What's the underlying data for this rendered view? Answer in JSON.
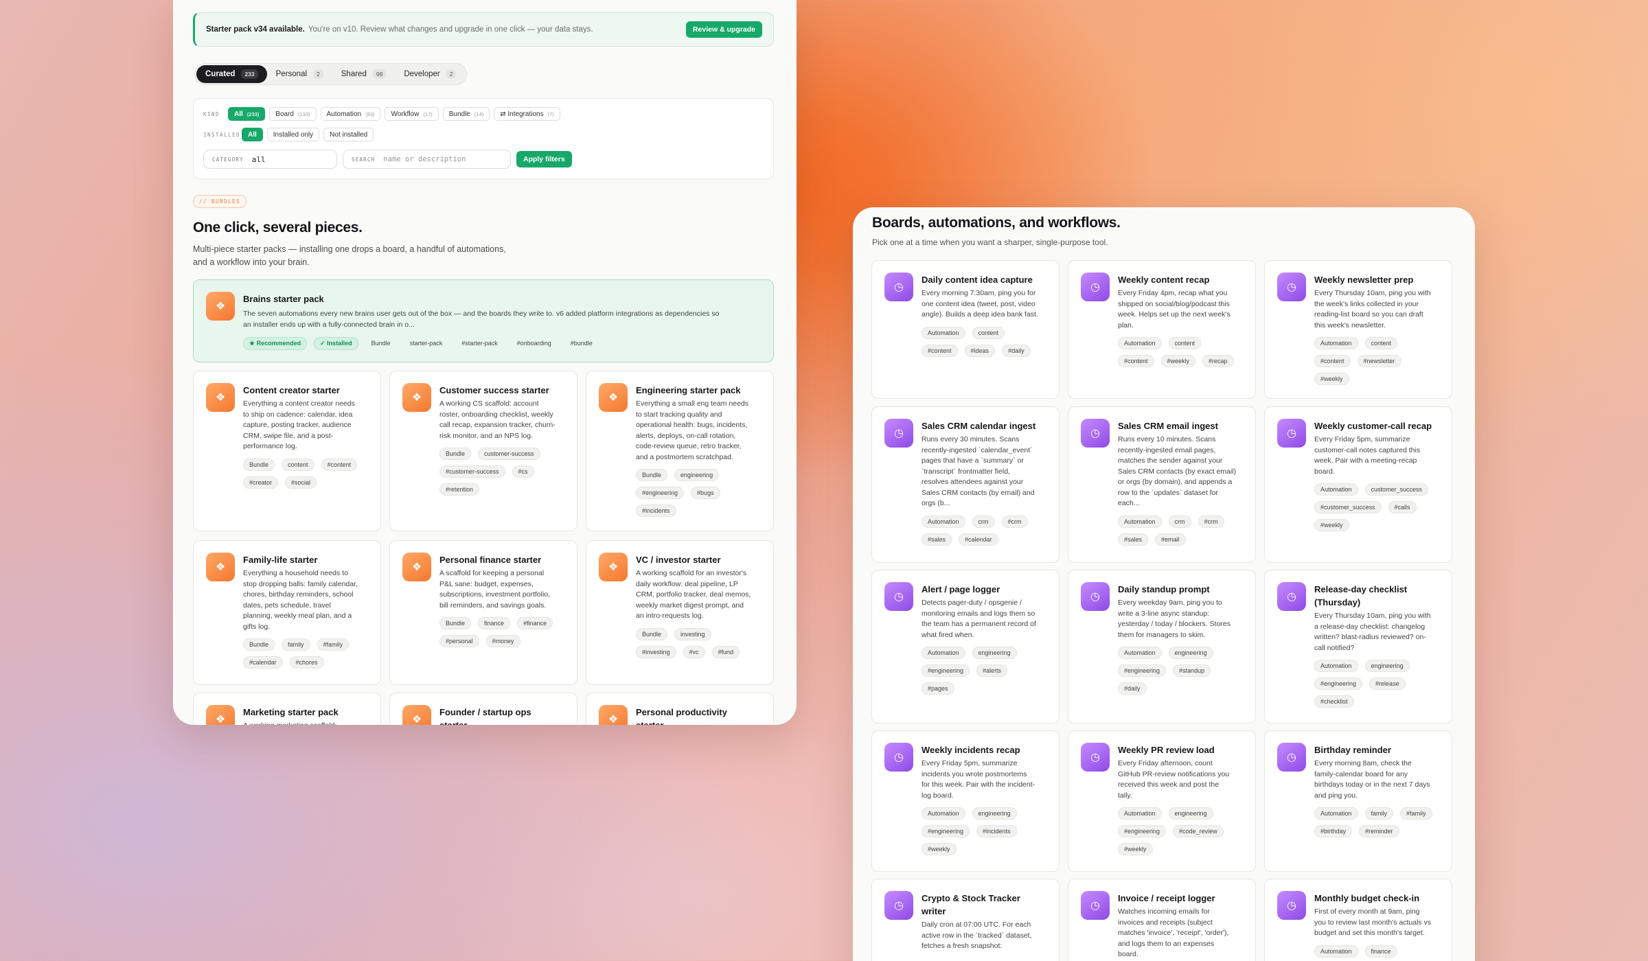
{
  "banner": {
    "title": "Starter pack v34 available.",
    "text": "You're on v10. Review what changes and upgrade in one click — your data stays.",
    "button": "Review & upgrade"
  },
  "tabs": [
    {
      "label": "Curated",
      "count": "233"
    },
    {
      "label": "Personal",
      "count": "2"
    },
    {
      "label": "Shared",
      "count": "98"
    },
    {
      "label": "Developer",
      "count": "2"
    }
  ],
  "filters": {
    "kind_label": "KIND",
    "kinds": [
      {
        "label": "All",
        "count": "(233)"
      },
      {
        "label": "Board",
        "count": "(133)"
      },
      {
        "label": "Automation",
        "count": "(83)"
      },
      {
        "label": "Workflow",
        "count": "(17)"
      },
      {
        "label": "Bundle",
        "count": "(14)"
      },
      {
        "label": "⇄ Integrations",
        "count": "(7)"
      }
    ],
    "installed_label": "INSTALLED",
    "installed": [
      "All",
      "Installed only",
      "Not installed"
    ],
    "category_label": "CATEGORY",
    "category_value": "all",
    "search_label": "SEARCH",
    "search_placeholder": "name or description",
    "apply": "Apply filters"
  },
  "bundles": {
    "kicker": "// BUNDLES",
    "heading": "One click, several pieces.",
    "sub_lines": [
      "Multi-piece starter packs — installing one drops a board, a handful of automations,",
      "and a workflow into your brain."
    ],
    "featured": {
      "title": "Brains starter pack",
      "desc_lines": [
        "The seven automations every new brains user gets out of the box — and the boards they write to. v6 added platform integrations as dependencies so",
        "an installer ends up with a fully-connected brain in o..."
      ],
      "tags": [
        "★ Recommended",
        "✓ Installed",
        "Bundle",
        "starter-pack",
        "#starter-pack",
        "#onboarding",
        "#bundle"
      ]
    },
    "cards": [
      {
        "title_lines": [
          "Content creator starter"
        ],
        "desc_lines": [
          "Everything a content creator needs",
          "to ship on cadence: calendar, idea",
          "capture, posting tracker, audience",
          "CRM, swipe file, and a post-",
          "performance log."
        ],
        "tags": [
          "Bundle",
          "content",
          "#content",
          "#creator",
          "#social"
        ]
      },
      {
        "title_lines": [
          "Customer success starter"
        ],
        "desc_lines": [
          "A working CS scaffold: account",
          "roster, onboarding checklist, weekly",
          "call recap, expansion tracker, churn-",
          "risk monitor, and an NPS log."
        ],
        "tags": [
          "Bundle",
          "customer-success",
          "#customer-success",
          "#cs",
          "#retention"
        ]
      },
      {
        "title_lines": [
          "Engineering starter pack"
        ],
        "desc_lines": [
          "Everything a small eng team needs",
          "to start tracking quality and",
          "operational health: bugs, incidents,",
          "alerts, deploys, on-call rotation,",
          "code-review queue, retro tracker,",
          "and a postmortem scratchpad."
        ],
        "tags": [
          "Bundle",
          "engineering",
          "#engineering",
          "#bugs",
          "#incidents"
        ]
      },
      {
        "title_lines": [
          "Family-life starter"
        ],
        "desc_lines": [
          "Everything a household needs to",
          "stop dropping balls: family calendar,",
          "chores, birthday reminders, school",
          "dates, pets schedule, travel",
          "planning, weekly meal plan, and a",
          "gifts log."
        ],
        "tags": [
          "Bundle",
          "family",
          "#family",
          "#calendar",
          "#chores"
        ]
      },
      {
        "title_lines": [
          "Personal finance starter"
        ],
        "desc_lines": [
          "A scaffold for keeping a personal",
          "P&L sane: budget, expenses,",
          "subscriptions, investment portfolio,",
          "bill reminders, and savings goals."
        ],
        "tags": [
          "Bundle",
          "finance",
          "#finance",
          "#personal",
          "#money"
        ]
      },
      {
        "title_lines": [
          "VC / investor starter"
        ],
        "desc_lines": [
          "A working scaffold for an investor's",
          "daily workflow: deal pipeline, LP",
          "CRM, portfolio tracker, deal memos,",
          "weekly market digest prompt, and",
          "an intro-requests log."
        ],
        "tags": [
          "Bundle",
          "investing",
          "#investing",
          "#vc",
          "#fund"
        ]
      },
      {
        "title_lines": [
          "Marketing starter pack"
        ],
        "desc_lines": [
          "A working marketing scaffold:"
        ],
        "tags": []
      },
      {
        "title_lines": [
          "Founder / startup ops",
          "starter"
        ],
        "desc_lines": [],
        "tags": []
      },
      {
        "title_lines": [
          "Personal productivity",
          "starter"
        ],
        "desc_lines": [],
        "tags": []
      }
    ]
  },
  "tools": {
    "heading": "Boards, automations, and workflows.",
    "sub": "Pick one at a time when you want a sharper, single-purpose tool.",
    "cards": [
      {
        "title_lines": [
          "Daily content idea capture"
        ],
        "desc_lines": [
          "Every morning 7:30am, ping you for",
          "one content idea (tweet, post, video",
          "angle). Builds a deep idea bank fast."
        ],
        "tags": [
          "Automation",
          "content",
          "#content",
          "#ideas",
          "#daily"
        ]
      },
      {
        "title_lines": [
          "Weekly content recap"
        ],
        "desc_lines": [
          "Every Friday 4pm, recap what you",
          "shipped on social/blog/podcast this",
          "week. Helps set up the next week's",
          "plan."
        ],
        "tags": [
          "Automation",
          "content",
          "#content",
          "#weekly",
          "#recap"
        ]
      },
      {
        "title_lines": [
          "Weekly newsletter prep"
        ],
        "desc_lines": [
          "Every Thursday 10am, ping you with",
          "the week's links collected in your",
          "reading-list board so you can draft",
          "this week's newsletter."
        ],
        "tags": [
          "Automation",
          "content",
          "#content",
          "#newsletter",
          "#weekly"
        ]
      },
      {
        "title_lines": [
          "Sales CRM calendar ingest"
        ],
        "desc_lines": [
          "Runs every 30 minutes. Scans",
          "recently-ingested `calendar_event`",
          "pages that have a `summary` or",
          "`transcript` frontmatter field,",
          "resolves attendees against your",
          "Sales CRM contacts (by email) and",
          "orgs (b..."
        ],
        "tags": [
          "Automation",
          "crm",
          "#crm",
          "#sales",
          "#calendar"
        ]
      },
      {
        "title_lines": [
          "Sales CRM email ingest"
        ],
        "desc_lines": [
          "Runs every 10 minutes. Scans",
          "recently-ingested email pages,",
          "matches the sender against your",
          "Sales CRM contacts (by exact email)",
          "or orgs (by domain), and appends a",
          "row to the `updates` dataset for",
          "each..."
        ],
        "tags": [
          "Automation",
          "crm",
          "#crm",
          "#sales",
          "#email"
        ]
      },
      {
        "title_lines": [
          "Weekly customer-call recap"
        ],
        "desc_lines": [
          "Every Friday 5pm, summarize",
          "customer-call notes captured this",
          "week. Pair with a meeting-recap",
          "board."
        ],
        "tags": [
          "Automation",
          "customer_success",
          "#customer_success",
          "#calls",
          "#weekly"
        ]
      },
      {
        "title_lines": [
          "Alert / page logger"
        ],
        "desc_lines": [
          "Detects pager-duty / opsgenie /",
          "monitoring emails and logs them so",
          "the team has a permanent record of",
          "what fired when."
        ],
        "tags": [
          "Automation",
          "engineering",
          "#engineering",
          "#alerts",
          "#pages"
        ]
      },
      {
        "title_lines": [
          "Daily standup prompt"
        ],
        "desc_lines": [
          "Every weekday 9am, ping you to",
          "write a 3-line async standup:",
          "yesterday / today / blockers. Stores",
          "them for managers to skim."
        ],
        "tags": [
          "Automation",
          "engineering",
          "#engineering",
          "#standup",
          "#daily"
        ]
      },
      {
        "title_lines": [
          "Release-day checklist",
          "(Thursday)"
        ],
        "desc_lines": [
          "Every Thursday 10am, ping you with",
          "a release-day checklist: changelog",
          "written? blast-radius reviewed? on-",
          "call notified?"
        ],
        "tags": [
          "Automation",
          "engineering",
          "#engineering",
          "#release",
          "#checklist"
        ]
      },
      {
        "title_lines": [
          "Weekly incidents recap"
        ],
        "desc_lines": [
          "Every Friday 5pm, summarize",
          "incidents you wrote postmortems",
          "for this week. Pair with the incident-",
          "log board."
        ],
        "tags": [
          "Automation",
          "engineering",
          "#engineering",
          "#incidents",
          "#weekly"
        ]
      },
      {
        "title_lines": [
          "Weekly PR review load"
        ],
        "desc_lines": [
          "Every Friday afternoon, count",
          "GitHub PR-review notifications you",
          "received this week and post the",
          "tally."
        ],
        "tags": [
          "Automation",
          "engineering",
          "#engineering",
          "#code_review",
          "#weekly"
        ]
      },
      {
        "title_lines": [
          "Birthday reminder"
        ],
        "desc_lines": [
          "Every morning 8am, check the",
          "family-calendar board for any",
          "birthdays today or in the next 7 days",
          "and ping you."
        ],
        "tags": [
          "Automation",
          "family",
          "#family",
          "#birthday",
          "#reminder"
        ]
      },
      {
        "title_lines": [
          "Crypto & Stock Tracker",
          "writer"
        ],
        "desc_lines": [
          "Daily cron at 07:00 UTC. For each",
          "active row in the `tracked` dataset,",
          "fetches a fresh snapshot:"
        ],
        "tags": []
      },
      {
        "title_lines": [
          "Invoice / receipt logger"
        ],
        "desc_lines": [
          "Watches incoming emails for",
          "invoices and receipts (subject",
          "matches 'invoice', 'receipt', 'order'),",
          "and logs them to an expenses",
          "board."
        ],
        "tags": []
      },
      {
        "title_lines": [
          "Monthly budget check-in"
        ],
        "desc_lines": [
          "First of every month at 9am, ping",
          "you to review last month's actuals vs",
          "budget and set this month's target."
        ],
        "tags": [
          "Automation",
          "finance"
        ]
      }
    ]
  },
  "icons": {
    "bundle": "bundle-icon",
    "tool": "clock-icon"
  }
}
